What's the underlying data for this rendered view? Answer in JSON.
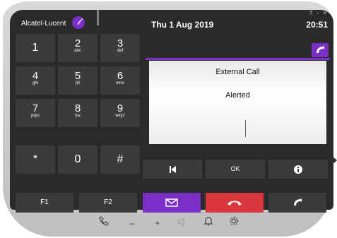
{
  "header": {
    "brand": "Alcatel·Lucent",
    "logo_glyph": "𝓁",
    "date": "Thu 1 Aug 2019",
    "time": "20:51",
    "window_controls": "? - ×"
  },
  "keypad": [
    {
      "digit": "1",
      "letters": ""
    },
    {
      "digit": "2",
      "letters": "abc"
    },
    {
      "digit": "3",
      "letters": "def"
    },
    {
      "digit": "4",
      "letters": "ghi"
    },
    {
      "digit": "5",
      "letters": "jkl"
    },
    {
      "digit": "6",
      "letters": "mno"
    },
    {
      "digit": "7",
      "letters": "pqrs"
    },
    {
      "digit": "8",
      "letters": "tuv"
    },
    {
      "digit": "9",
      "letters": "wxyz"
    },
    {
      "digit": "*",
      "letters": ""
    },
    {
      "digit": "0",
      "letters": ""
    },
    {
      "digit": "#",
      "letters": ""
    }
  ],
  "call": {
    "type_label": "External Call",
    "status_label": "Alerted"
  },
  "controls": {
    "ok_label": "OK",
    "f1_label": "F1",
    "f2_label": "F2"
  },
  "icons": {
    "skip_back": "skip-back-icon",
    "info": "info-icon",
    "next": "next-arrow-icon",
    "message": "message-icon",
    "hangup": "hangup-icon",
    "pickup": "pickup-icon",
    "handset": "handset-icon",
    "volume_down": "minus-icon",
    "volume_up": "plus-icon",
    "speaker": "speaker-icon",
    "bell": "bell-icon",
    "settings": "gear-icon"
  },
  "colors": {
    "accent": "#7a2fc6",
    "hangup": "#d9363e",
    "key_bg": "#3b3b3b",
    "screen_bg": "#2a2a2a"
  }
}
